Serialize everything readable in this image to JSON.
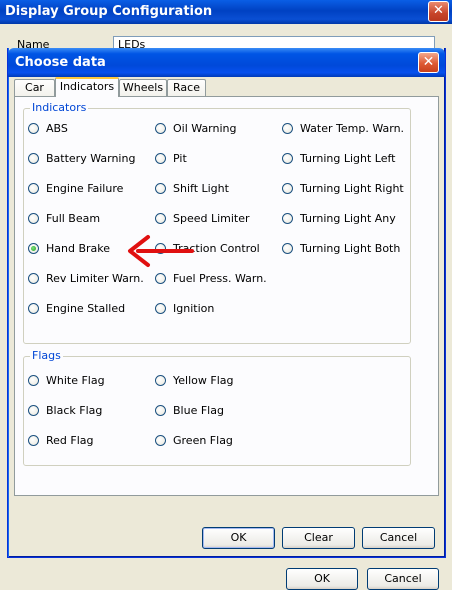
{
  "outer": {
    "title": "Display Group Configuration",
    "close_glyph": "✕",
    "name_label": "Name",
    "name_value": "LEDs",
    "ok_label": "OK",
    "cancel_label": "Cancel"
  },
  "dialog": {
    "title": "Choose data",
    "close_glyph": "✕",
    "tabs": [
      {
        "label": "Car"
      },
      {
        "label": "Indicators"
      },
      {
        "label": "Wheels"
      },
      {
        "label": "Race"
      }
    ],
    "active_tab": "Indicators",
    "indicators": {
      "legend": "Indicators",
      "col1": [
        "ABS",
        "Battery Warning",
        "Engine Failure",
        "Full Beam",
        "Hand Brake",
        "Rev Limiter Warn.",
        "Engine Stalled"
      ],
      "col2": [
        "Oil Warning",
        "Pit",
        "Shift Light",
        "Speed Limiter",
        "Traction Control",
        "Fuel Press. Warn.",
        "Ignition"
      ],
      "col3": [
        "Water Temp. Warn.",
        "Turning Light Left",
        "Turning Light Right",
        "Turning Light Any",
        "Turning Light Both"
      ],
      "selected": "Hand Brake"
    },
    "flags": {
      "legend": "Flags",
      "col1": [
        "White Flag",
        "Black Flag",
        "Red Flag"
      ],
      "col2": [
        "Yellow Flag",
        "Blue Flag",
        "Green Flag"
      ]
    },
    "buttons": {
      "ok": "OK",
      "clear": "Clear",
      "cancel": "Cancel"
    }
  },
  "colors": {
    "annotation_arrow": "#e01010",
    "group_legend": "#0046d5",
    "titlebar": "#0055e5"
  }
}
